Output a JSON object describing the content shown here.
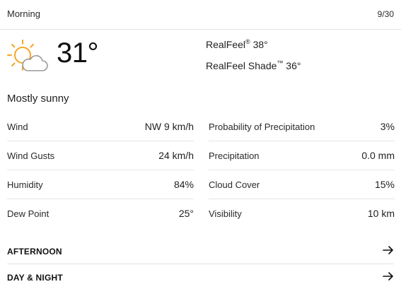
{
  "header": {
    "period": "Morning",
    "date": "9/30"
  },
  "current": {
    "icon": "partly-sunny-icon",
    "temperature": "31°",
    "realfeel_label": "RealFeel",
    "realfeel_value": "38°",
    "realfeel_shade_label": "RealFeel Shade",
    "realfeel_shade_value": "36°",
    "phrase": "Mostly sunny"
  },
  "details_left": [
    {
      "label": "Wind",
      "value": "NW 9 km/h"
    },
    {
      "label": "Wind Gusts",
      "value": "24 km/h"
    },
    {
      "label": "Humidity",
      "value": "84%"
    },
    {
      "label": "Dew Point",
      "value": "25°"
    }
  ],
  "details_right": [
    {
      "label": "Probability of Precipitation",
      "value": "3%"
    },
    {
      "label": "Precipitation",
      "value": "0.0 mm"
    },
    {
      "label": "Cloud Cover",
      "value": "15%"
    },
    {
      "label": "Visibility",
      "value": "10 km"
    }
  ],
  "links": [
    {
      "label": "AFTERNOON",
      "icon": "arrow-right-icon"
    },
    {
      "label": "DAY & NIGHT",
      "icon": "arrow-right-icon"
    }
  ],
  "colors": {
    "sun": "#f5a623",
    "cloud_stroke": "#9a9a9a",
    "divider": "#e6e6e6"
  }
}
